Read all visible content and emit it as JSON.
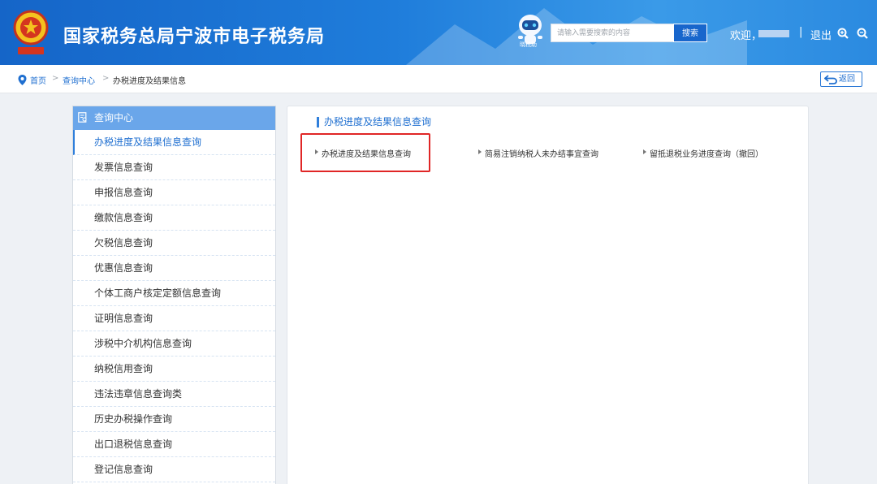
{
  "header": {
    "emblem_text": "中国税务",
    "title": "国家税务总局宁波市电子税务局",
    "robot_label": "晓税助",
    "search_placeholder": "请输入需要搜索的内容",
    "search_button": "搜索",
    "welcome": "欢迎，",
    "separator": "|",
    "logout": "退出"
  },
  "breadcrumb": {
    "home": "首页",
    "arrow": ">",
    "query_center": "查询中心",
    "current": "办税进度及结果信息",
    "back": "返回"
  },
  "sidebar": {
    "header": "查询中心",
    "items": [
      {
        "label": "办税进度及结果信息查询",
        "active": true
      },
      {
        "label": "发票信息查询"
      },
      {
        "label": "申报信息查询"
      },
      {
        "label": "缴款信息查询"
      },
      {
        "label": "欠税信息查询"
      },
      {
        "label": "优惠信息查询"
      },
      {
        "label": "个体工商户核定定额信息查询"
      },
      {
        "label": "证明信息查询"
      },
      {
        "label": "涉税中介机构信息查询"
      },
      {
        "label": "纳税信用查询"
      },
      {
        "label": "违法违章信息查询类"
      },
      {
        "label": "历史办税操作查询"
      },
      {
        "label": "出口退税信息查询"
      },
      {
        "label": "登记信息查询"
      }
    ]
  },
  "main": {
    "title": "办税进度及结果信息查询",
    "links": [
      {
        "label": "办税进度及结果信息查询"
      },
      {
        "label": "简易注销纳税人未办结事宜查询"
      },
      {
        "label": "留抵退税业务进度查询（撤回）"
      }
    ]
  },
  "colors": {
    "header_blue": "#1f7ddb",
    "link_blue": "#1f6fd0",
    "sidebar_header": "#6aa6ea",
    "highlight_red": "#e02626"
  }
}
